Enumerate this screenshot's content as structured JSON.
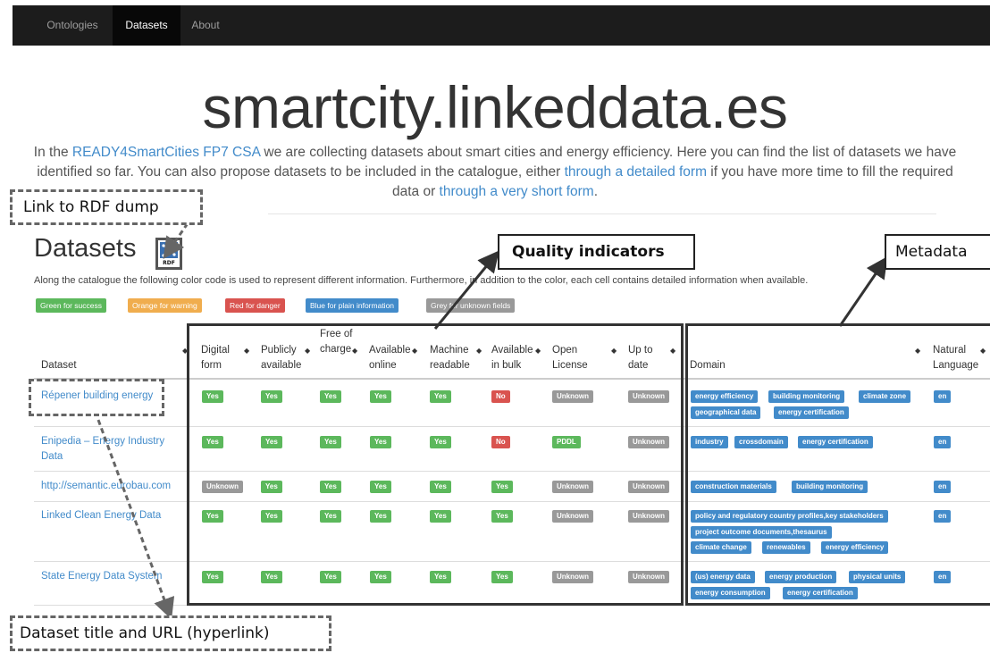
{
  "nav": {
    "items": [
      "Ontologies",
      "Datasets",
      "About"
    ],
    "active": "Datasets"
  },
  "site_title": "smartcity.linkeddata.es",
  "intro": {
    "t1": "In the ",
    "link1": "READY4SmartCities FP7 CSA",
    "t2": " we are collecting datasets about smart cities and energy efficiency. Here you can find the list of datasets we have identified so far. You can also propose datasets to be included in the catalogue, either ",
    "link2": "through a detailed form",
    "t3": " if you have more time to fill the required data or ",
    "link3": "through a very short form",
    "t4": "."
  },
  "section_title": "Datasets",
  "rdf_icon_label": "RDF",
  "description": "Along the catalogue the following color code is used to represent different information. Furthermore, in addition to the color, each cell contains detailed information when available.",
  "legend": [
    {
      "label": "Green for success",
      "color": "#5cb85c"
    },
    {
      "label": "Orange for warning",
      "color": "#f0ad4e"
    },
    {
      "label": "Red for danger",
      "color": "#d9534f"
    },
    {
      "label": "Blue for plain information",
      "color": "#428bca"
    },
    {
      "label": "Grey for unknown fields",
      "color": "#999999"
    }
  ],
  "columns": {
    "dataset": "Dataset",
    "digital_form": "Digital form",
    "publicly_available": "Publicly available",
    "free_of_charge": "Free of charge",
    "available_online": "Available online",
    "machine_readable": "Machine readable",
    "available_in_bulk": "Available in bulk",
    "open_license": "Open License",
    "up_to_date": "Up to date",
    "domain": "Domain",
    "natural_language": "Natural Language"
  },
  "rows": [
    {
      "name": "Répener building energy",
      "quality": [
        "Yes",
        "Yes",
        "Yes",
        "Yes",
        "Yes",
        "No",
        "Unknown",
        "Unknown"
      ],
      "domain": [
        "energy efficiency",
        "building monitoring",
        "climate zone",
        "geographical data",
        "energy certification"
      ],
      "language": "en"
    },
    {
      "name": "Enipedia – Energy Industry Data",
      "quality": [
        "Yes",
        "Yes",
        "Yes",
        "Yes",
        "Yes",
        "No",
        "PDDL",
        "Unknown"
      ],
      "domain": [
        "industry",
        "crossdomain",
        "energy certification"
      ],
      "language": "en"
    },
    {
      "name": "http://semantic.eurobau.com",
      "quality": [
        "Unknown",
        "Yes",
        "Yes",
        "Yes",
        "Yes",
        "Yes",
        "Unknown",
        "Unknown"
      ],
      "domain": [
        "construction materials",
        "building monitoring"
      ],
      "language": "en"
    },
    {
      "name": "Linked Clean Energy Data",
      "quality": [
        "Yes",
        "Yes",
        "Yes",
        "Yes",
        "Yes",
        "Yes",
        "Unknown",
        "Unknown"
      ],
      "domain": [
        "policy and regulatory country profiles,key stakeholders",
        "project outcome documents,thesaurus",
        "climate change",
        "renewables",
        "energy efficiency"
      ],
      "language": "en"
    },
    {
      "name": "State Energy Data System",
      "quality": [
        "Yes",
        "Yes",
        "Yes",
        "Yes",
        "Yes",
        "Yes",
        "Unknown",
        "Unknown"
      ],
      "domain": [
        "(us) energy data",
        "energy production",
        "physical units",
        "energy consumption",
        "energy certification"
      ],
      "language": "en"
    }
  ],
  "callouts": {
    "rdf_dump": "Link to RDF dump",
    "quality_indicators": "Quality indicators",
    "metadata": "Metadata",
    "dataset_title": "Dataset title and URL (hyperlink)"
  },
  "colors": {
    "navbar": "#1c1c1c",
    "link": "#428bca",
    "success": "#5cb85c",
    "danger": "#d9534f",
    "unknown": "#999999",
    "info": "#428bca"
  }
}
